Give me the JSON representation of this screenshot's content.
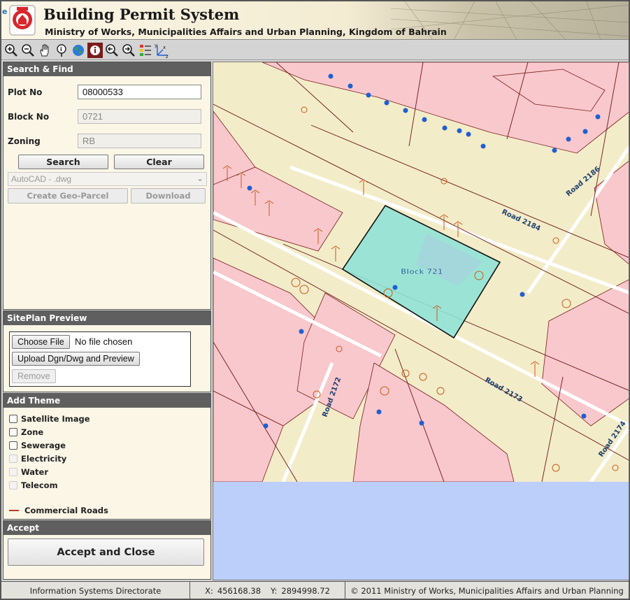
{
  "header": {
    "title": "Building Permit System",
    "subtitle": "Ministry of Works, Municipalities Affairs and Urban Planning, Kingdom of Bahrain",
    "browser_badge": "e"
  },
  "toolbar": {
    "tools": [
      {
        "name": "zoom-in-icon",
        "active": false
      },
      {
        "name": "zoom-out-icon",
        "active": false
      },
      {
        "name": "pan-hand-icon",
        "active": false
      },
      {
        "name": "identify-pin-icon",
        "active": false
      },
      {
        "name": "full-extent-globe-icon",
        "active": false
      },
      {
        "name": "info-icon",
        "active": true
      },
      {
        "name": "previous-extent-icon",
        "active": false
      },
      {
        "name": "next-extent-icon",
        "active": false
      },
      {
        "name": "legend-icon",
        "active": false
      },
      {
        "name": "coordinates-xyz-icon",
        "active": false
      }
    ]
  },
  "search": {
    "heading": "Search & Find",
    "plot_label": "Plot No",
    "plot_value": "08000533",
    "block_label": "Block No",
    "block_value": "0721",
    "zoning_label": "Zoning",
    "zoning_value": "RB",
    "search_button": "Search",
    "clear_button": "Clear",
    "format_selected": "AutoCAD - .dwg",
    "create_geo_parcel": "Create Geo-Parcel",
    "download": "Download"
  },
  "siteplan": {
    "heading": "SitePlan Preview",
    "choose_file": "Choose File",
    "no_file": "No file chosen",
    "upload": "Upload Dgn/Dwg and Preview",
    "remove": "Remove"
  },
  "themes": {
    "heading": "Add Theme",
    "items": [
      {
        "label": "Satellite Image",
        "enabled": true
      },
      {
        "label": "Zone",
        "enabled": true
      },
      {
        "label": "Sewerage",
        "enabled": true
      },
      {
        "label": "Electricity",
        "enabled": false
      },
      {
        "label": "Water",
        "enabled": false
      },
      {
        "label": "Telecom",
        "enabled": false
      }
    ],
    "legend_label": "Commercial Roads",
    "legend_color": "#c0392b"
  },
  "accept": {
    "heading": "Accept",
    "button": "Accept and Close"
  },
  "map": {
    "labels": {
      "block": "Block 721",
      "road_2184": "Road 2184",
      "road_2186": "Road 2186",
      "road_2172": "Road 2172",
      "road_2173": "Road 2173",
      "road_2174": "Road 2174"
    },
    "colors": {
      "residential": "#f9c8cc",
      "road": "#f3ecc8",
      "selected_parcel": "#8ee3d6",
      "water": "#bccefa",
      "feature_line": "#c85a1a",
      "point": "#1f5fd4"
    }
  },
  "status": {
    "org": "Information Systems Directorate",
    "x_label": "X:",
    "x_value": "456168.38",
    "y_label": "Y:",
    "y_value": "2894998.72",
    "copyright": "© 2011 Ministry of Works, Municipalities Affairs and Urban Planning"
  }
}
